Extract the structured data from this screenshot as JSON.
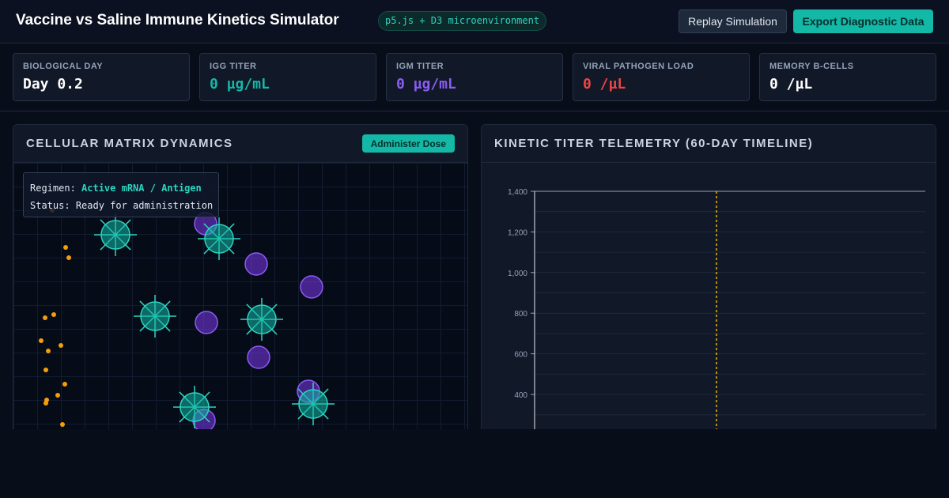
{
  "header": {
    "title": "Vaccine vs Saline Immune Kinetics Simulator",
    "badge": "p5.js + D3 microenvironment",
    "replay_label": "Replay Simulation",
    "export_label": "Export Diagnostic Data"
  },
  "stats": [
    {
      "label": "Biological Day",
      "value": "Day 0.2",
      "color": "#ffffff"
    },
    {
      "label": "IgG Titer",
      "value": "0 µg/mL",
      "color": "#14b8a6"
    },
    {
      "label": "IgM Titer",
      "value": "0 µg/mL",
      "color": "#8b5cf6"
    },
    {
      "label": "Viral Pathogen Load",
      "value": "0 /µL",
      "color": "#ef4444"
    },
    {
      "label": "Memory B-Cells",
      "value": "0 /µL",
      "color": "#ffffff"
    }
  ],
  "left_panel": {
    "title": "Cellular Matrix Dynamics",
    "dose_label": "Administer Dose",
    "regimen_label": "Regimen:",
    "regimen_value": "Active mRNA / Antigen",
    "status_label": "Status:",
    "status_value": "Ready for administration"
  },
  "right_panel": {
    "title": "Kinetic Titer Telemetry (60-Day Timeline)"
  },
  "chart_data": {
    "type": "line",
    "title": "Kinetic Titer Telemetry (60-Day Timeline)",
    "y_ticks": [
      "1,400",
      "1,200",
      "1,000",
      "800",
      "600",
      "400"
    ],
    "y_tick_values": [
      1400,
      1200,
      1000,
      800,
      600,
      400
    ],
    "ylim": [
      400,
      1400
    ],
    "grid": true,
    "series": []
  },
  "colors": {
    "accent_teal": "#14b8a6",
    "igm_purple": "#8b5cf6",
    "viral_red": "#ef4444",
    "particle_orange": "#f59e0b"
  },
  "icons": {
    "t_cell": "spiked-cell-icon",
    "b_cell": "circle-cell-icon",
    "antigen": "dot-particle-icon"
  }
}
